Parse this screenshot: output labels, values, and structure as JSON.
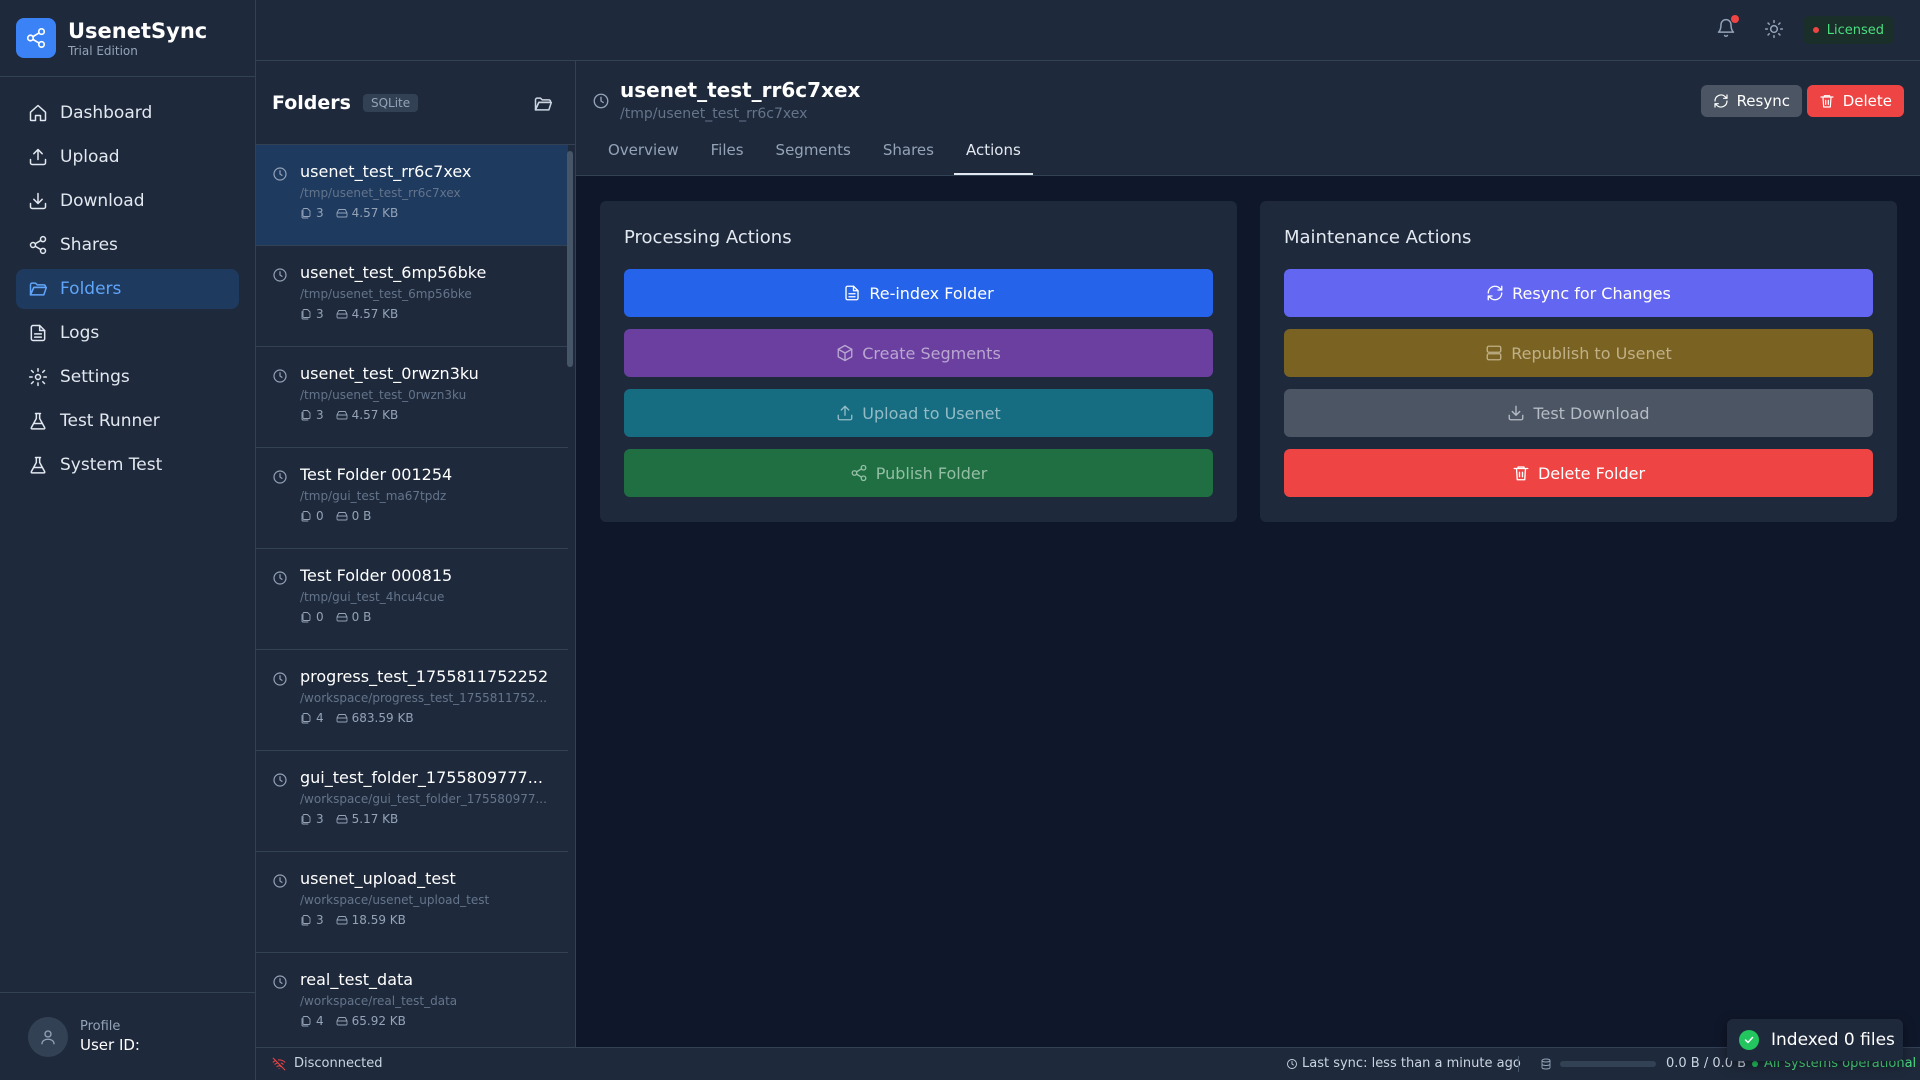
{
  "app": {
    "name": "UsenetSync",
    "edition": "Trial Edition"
  },
  "sidebar": {
    "items": [
      {
        "label": "Dashboard",
        "icon": "home-icon"
      },
      {
        "label": "Upload",
        "icon": "upload-icon"
      },
      {
        "label": "Download",
        "icon": "download-icon"
      },
      {
        "label": "Shares",
        "icon": "share-icon"
      },
      {
        "label": "Folders",
        "icon": "folder-icon",
        "active": true
      },
      {
        "label": "Logs",
        "icon": "file-text-icon"
      },
      {
        "label": "Settings",
        "icon": "gear-icon"
      },
      {
        "label": "Test Runner",
        "icon": "flask-icon"
      },
      {
        "label": "System Test",
        "icon": "flask-icon"
      }
    ],
    "profile": {
      "label": "Profile",
      "user": "User ID:"
    }
  },
  "topbar": {
    "license": "Licensed",
    "notifications_unread": true
  },
  "folders_panel": {
    "title": "Folders",
    "db_badge": "SQLite",
    "items": [
      {
        "name": "usenet_test_rr6c7xex",
        "path": "/tmp/usenet_test_rr6c7xex",
        "files": "3",
        "size": "4.57 KB",
        "selected": true
      },
      {
        "name": "usenet_test_6mp56bke",
        "path": "/tmp/usenet_test_6mp56bke",
        "files": "3",
        "size": "4.57 KB"
      },
      {
        "name": "usenet_test_0rwzn3ku",
        "path": "/tmp/usenet_test_0rwzn3ku",
        "files": "3",
        "size": "4.57 KB"
      },
      {
        "name": "Test Folder 001254",
        "path": "/tmp/gui_test_ma67tpdz",
        "files": "0",
        "size": "0 B"
      },
      {
        "name": "Test Folder 000815",
        "path": "/tmp/gui_test_4hcu4cue",
        "files": "0",
        "size": "0 B"
      },
      {
        "name": "progress_test_1755811752252",
        "path": "/workspace/progress_test_1755811752...",
        "files": "4",
        "size": "683.59 KB"
      },
      {
        "name": "gui_test_folder_1755809777...",
        "path": "/workspace/gui_test_folder_175580977...",
        "files": "3",
        "size": "5.17 KB"
      },
      {
        "name": "usenet_upload_test",
        "path": "/workspace/usenet_upload_test",
        "files": "3",
        "size": "18.59 KB"
      },
      {
        "name": "real_test_data",
        "path": "/workspace/real_test_data",
        "files": "4",
        "size": "65.92 KB"
      }
    ]
  },
  "detail": {
    "title": "usenet_test_rr6c7xex",
    "path": "/tmp/usenet_test_rr6c7xex",
    "resync_label": "Resync",
    "delete_label": "Delete",
    "tabs": [
      "Overview",
      "Files",
      "Segments",
      "Shares",
      "Actions"
    ],
    "active_tab": "Actions",
    "processing": {
      "title": "Processing Actions",
      "buttons": [
        {
          "label": "Re-index Folder",
          "icon": "file-text-icon",
          "color": "#2563eb",
          "enabled": true
        },
        {
          "label": "Create Segments",
          "icon": "package-icon",
          "color": "#6b3fa0",
          "enabled": false
        },
        {
          "label": "Upload to Usenet",
          "icon": "upload-icon",
          "color": "#166c80",
          "enabled": false
        },
        {
          "label": "Publish Folder",
          "icon": "share-icon",
          "color": "#1f6f42",
          "enabled": false
        }
      ]
    },
    "maintenance": {
      "title": "Maintenance Actions",
      "buttons": [
        {
          "label": "Resync for Changes",
          "icon": "refresh-icon",
          "color": "#6366f1",
          "enabled": true
        },
        {
          "label": "Republish to Usenet",
          "icon": "server-icon",
          "color": "#7a6322",
          "enabled": false
        },
        {
          "label": "Test Download",
          "icon": "download-icon",
          "color": "#4b5563",
          "enabled": false
        },
        {
          "label": "Delete Folder",
          "icon": "trash-icon",
          "color": "#ef4444",
          "enabled": true
        }
      ]
    }
  },
  "statusbar": {
    "connection": "Disconnected",
    "last_sync": "Last sync: less than a minute ago",
    "transfer": "0.0 B / 0.0 B",
    "transfer_progress": 0,
    "system": "All systems operational"
  },
  "toast": {
    "message": "Indexed 0 files"
  }
}
